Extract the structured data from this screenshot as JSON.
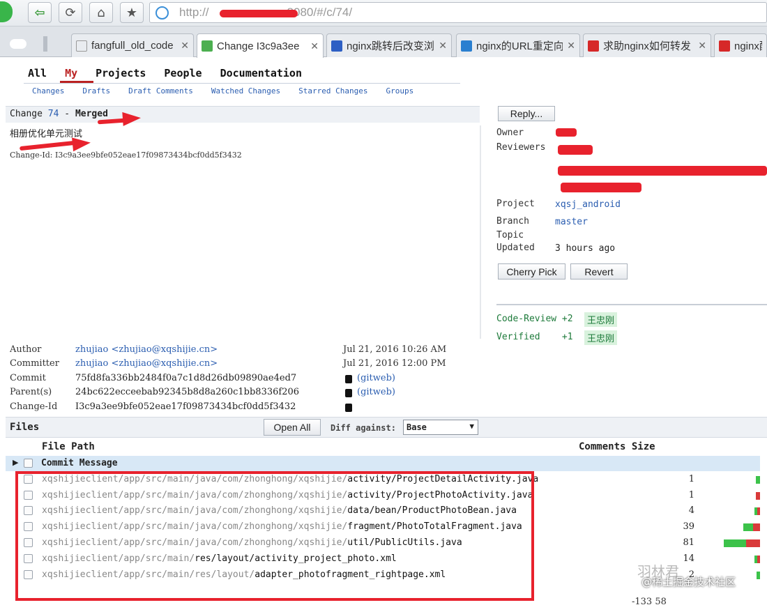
{
  "browser": {
    "url_prefix": "http://",
    "url_suffix": "8080/#/c/74/",
    "tabs": [
      {
        "title": "fangfull_old_code",
        "fav_color": "#ffffff",
        "active": false
      },
      {
        "title": "Change I3c9a3ee",
        "fav_color": "#4caf50",
        "active": true
      },
      {
        "title": "nginx跳转后改变浏",
        "fav_color": "#2d5fc4",
        "active": false
      },
      {
        "title": "nginx的URL重定向",
        "fav_color": "#2a7fd0",
        "active": false
      },
      {
        "title": "求助nginx如何转发",
        "fav_color": "#d62828",
        "active": false
      },
      {
        "title": "nginx配",
        "fav_color": "#d62828",
        "active": false
      }
    ]
  },
  "nav": {
    "top": [
      "All",
      "My",
      "Projects",
      "People",
      "Documentation"
    ],
    "selected": "My",
    "sub": [
      "Changes",
      "Drafts",
      "Draft Comments",
      "Watched Changes",
      "Starred Changes",
      "Groups"
    ]
  },
  "change": {
    "label": "Change",
    "number": "74",
    "dash": "-",
    "status": "Merged",
    "commit_message": "相册优化单元测试",
    "change_id_line": "Change-Id: I3c9a3ee9bfe052eae17f09873434bcf0dd5f3432"
  },
  "side": {
    "reply": "Reply...",
    "owner_label": "Owner",
    "reviewers_label": "Reviewers",
    "project_label": "Project",
    "project": "xqsj_android",
    "branch_label": "Branch",
    "branch": "master",
    "topic_label": "Topic",
    "updated_label": "Updated",
    "updated": "3 hours ago",
    "cherry_pick": "Cherry Pick",
    "revert": "Revert",
    "votes": [
      {
        "label": "Code-Review +2",
        "name": "王忠刚"
      },
      {
        "label": "Verified    +1",
        "name": "王忠刚"
      }
    ]
  },
  "meta": {
    "author_label": "Author",
    "author": "zhujiao <zhujiao@xqshijie.cn>",
    "author_date": "Jul 21, 2016 10:26 AM",
    "committer_label": "Committer",
    "committer": "zhujiao <zhujiao@xqshijie.cn>",
    "committer_date": "Jul 21, 2016 12:00 PM",
    "commit_label": "Commit",
    "commit": "75fd8fa336bb2484f0a7c1d8d26db09890ae4ed7",
    "gitweb": "(gitweb)",
    "parent_label": "Parent(s)",
    "parent": "24bc622ecceebab92345b8d8a260c1bb8336f206",
    "changeid_label": "Change-Id",
    "changeid": "I3c9a3ee9bfe052eae17f09873434bcf0dd5f3432"
  },
  "files": {
    "title": "Files",
    "open_all": "Open All",
    "diff_against_label": "Diff against:",
    "diff_against_value": "Base",
    "col_path": "File Path",
    "col_comments_size": "Comments Size",
    "commit_message_row": "Commit Message",
    "rows": [
      {
        "prefix": "xqshijieclient/app/src/main/java/com/zhonghong/xqshijie/",
        "suffix": "activity/ProjectDetailActivity.java",
        "count": "1",
        "green": 6,
        "red": 0
      },
      {
        "prefix": "xqshijieclient/app/src/main/java/com/zhonghong/xqshijie/",
        "suffix": "activity/ProjectPhotoActivity.java",
        "count": "1",
        "green": 0,
        "red": 6
      },
      {
        "prefix": "xqshijieclient/app/src/main/java/com/zhonghong/xqshijie/",
        "suffix": "data/bean/ProductPhotoBean.java",
        "count": "4",
        "green": 4,
        "red": 4
      },
      {
        "prefix": "xqshijieclient/app/src/main/java/com/zhonghong/xqshijie/",
        "suffix": "fragment/PhotoTotalFragment.java",
        "count": "39",
        "green": 14,
        "red": 10
      },
      {
        "prefix": "xqshijieclient/app/src/main/java/com/zhonghong/xqshijie/",
        "suffix": "util/PublicUtils.java",
        "count": "81",
        "green": 32,
        "red": 20
      },
      {
        "prefix": "xqshijieclient/app/src/main/",
        "suffix": "res/layout/activity_project_photo.xml",
        "count": "14",
        "green": 4,
        "red": 4
      },
      {
        "prefix": "xqshijieclient/app/src/main/res/layout/",
        "suffix": "adapter_photofragment_rightpage.xml",
        "count": "2",
        "green": 5,
        "red": 0
      }
    ],
    "partial_bottom": "-133   58"
  },
  "watermark": {
    "line1": "羽林君",
    "line2": "@稀土掘金技术社区"
  }
}
